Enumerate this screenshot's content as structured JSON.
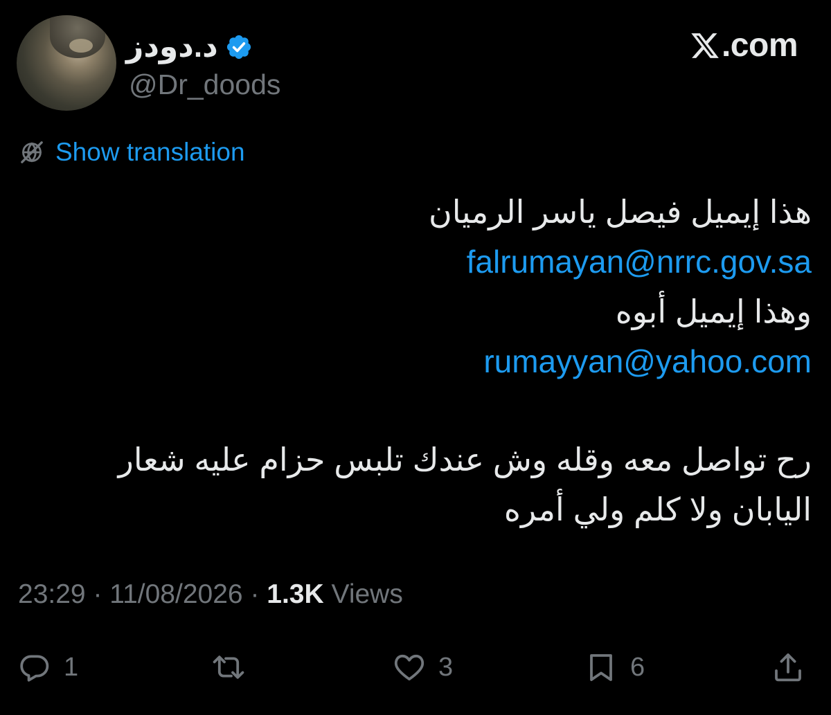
{
  "brand": {
    "logo_text": ".com",
    "logo_icon": "x-logo-icon"
  },
  "author": {
    "display_name": "د.دودز",
    "handle": "@Dr_doods",
    "verified": true,
    "verified_color": "#1d9bf0"
  },
  "translation": {
    "label": "Show translation",
    "icon": "globe-slash-icon"
  },
  "tweet": {
    "line1": "هذا إيميل فيصل ياسر الرميان",
    "email1": "falrumayan@nrrc.gov.sa",
    "line2": "وهذا إيميل أبوه",
    "email2": "rumayyan@yahoo.com",
    "line3": "رح تواصل معه وقله وش عندك تلبس حزام عليه شعار",
    "line4": "اليابان ولا كلم ولي أمره"
  },
  "meta": {
    "time": "23:29",
    "separator": "·",
    "date": "11/08/2026",
    "views_count": "1.3K",
    "views_label": "Views"
  },
  "actions": {
    "reply_count": "1",
    "retweet_count": "",
    "like_count": "3",
    "bookmark_count": "6"
  },
  "colors": {
    "background": "#000000",
    "text": "#e7e9ea",
    "secondary": "#71767b",
    "accent": "#1d9bf0"
  }
}
